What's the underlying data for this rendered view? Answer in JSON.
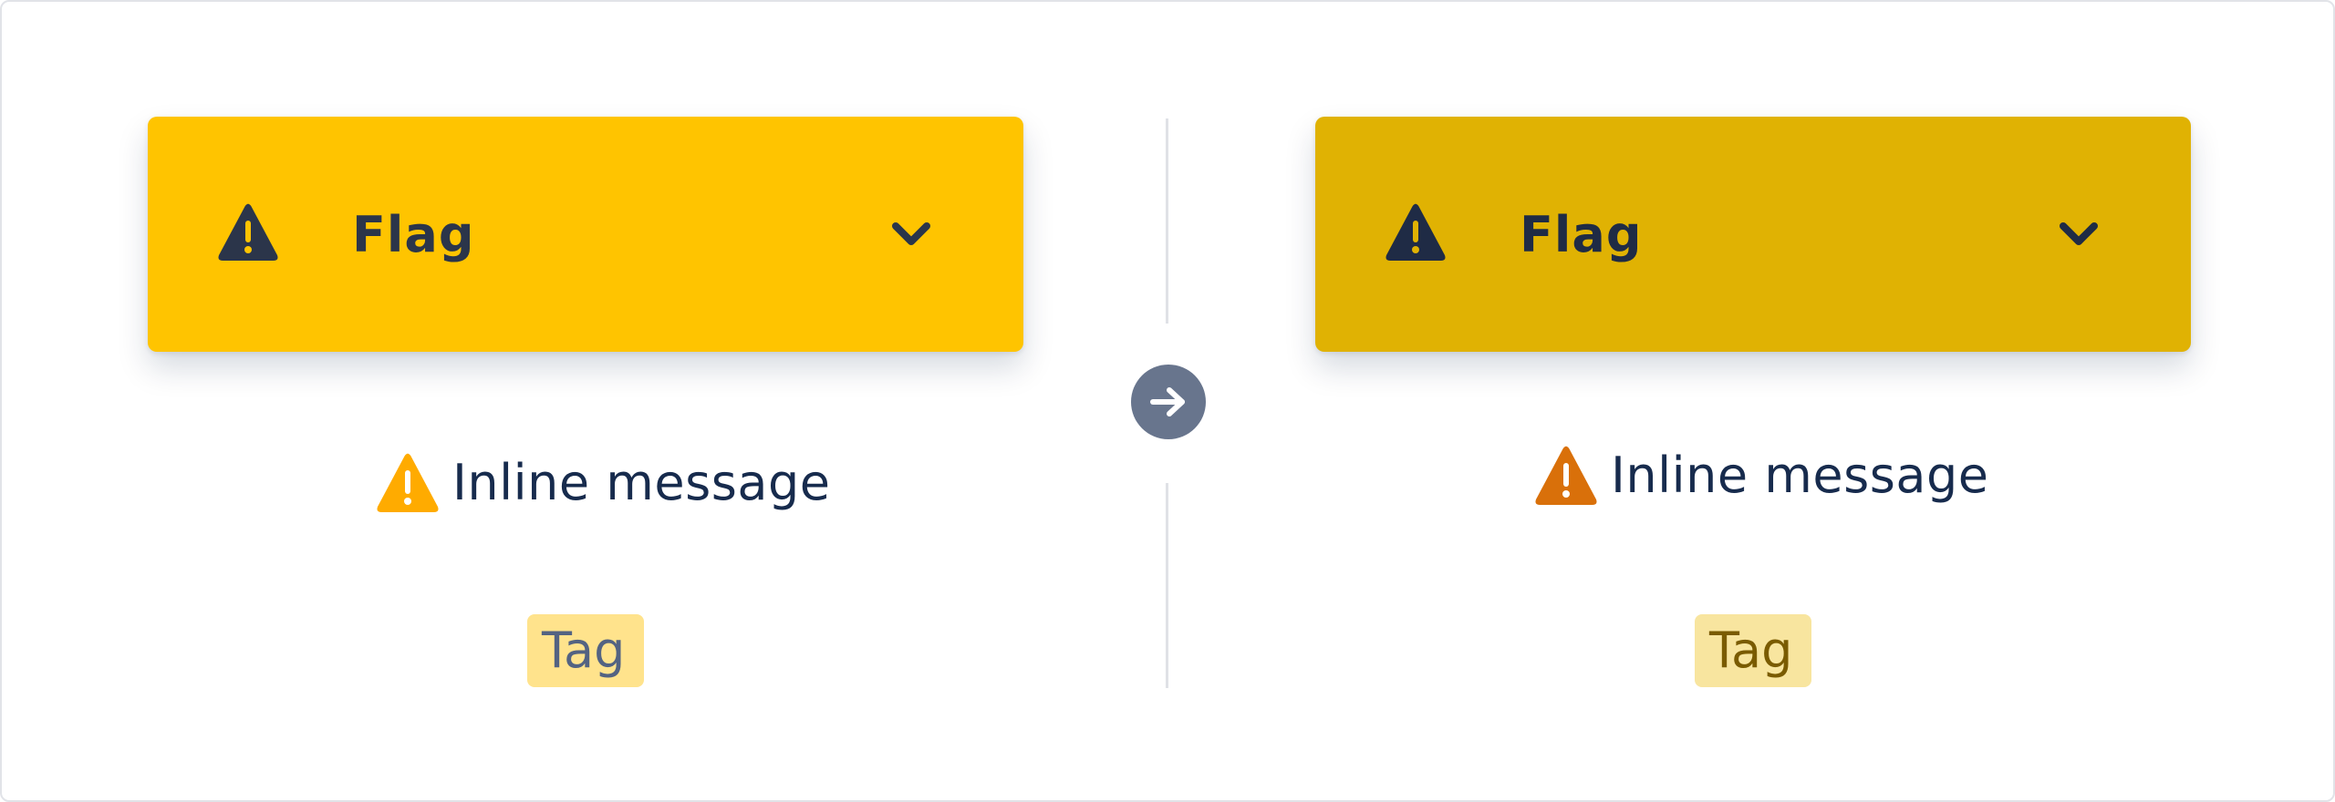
{
  "colors": {
    "flag_before_bg": "#ffc400",
    "flag_after_bg": "#e0b203",
    "flag_text": "#2b354a",
    "warning_before": "#ffab00",
    "warning_after": "#d9700a",
    "tag_before_bg": "#ffe38c",
    "tag_before_text": "#536382",
    "tag_after_bg": "#f8e59f",
    "tag_after_text": "#7a5b00",
    "arrow_button_bg": "#68758d"
  },
  "before": {
    "flag": {
      "icon": "warning-icon",
      "label": "Flag",
      "chevron": "chevron-down-icon"
    },
    "inline_message": {
      "icon": "warning-icon",
      "text": "Inline message"
    },
    "tag": {
      "label": "Tag"
    }
  },
  "transition": {
    "icon": "arrow-right-icon"
  },
  "after": {
    "flag": {
      "icon": "warning-icon",
      "label": "Flag",
      "chevron": "chevron-down-icon"
    },
    "inline_message": {
      "icon": "warning-icon",
      "text": "Inline message"
    },
    "tag": {
      "label": "Tag"
    }
  }
}
